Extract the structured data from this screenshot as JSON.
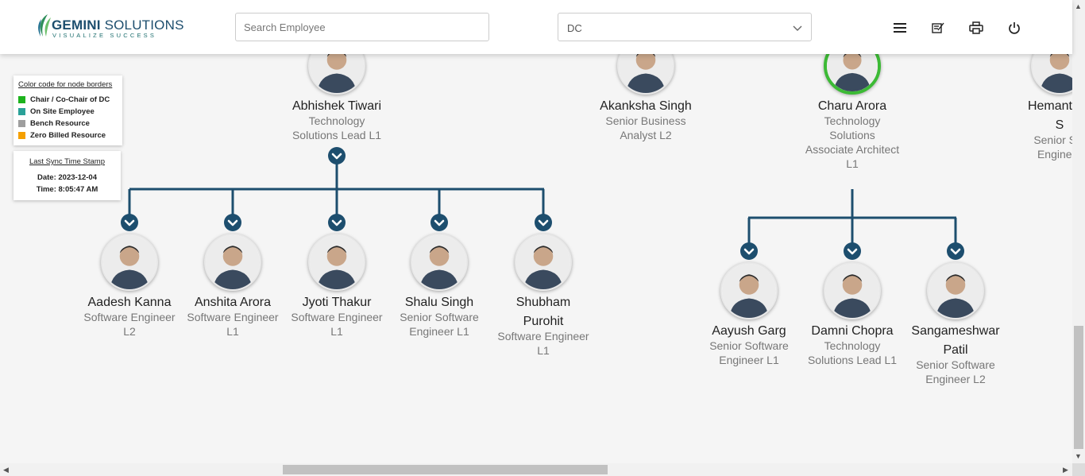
{
  "brand": {
    "name_bold": "GEMINI",
    "name_rest": " SOLUTIONS",
    "tagline": "VISUALIZE SUCCESS"
  },
  "search": {
    "placeholder": "Search Employee"
  },
  "filter": {
    "selected": "DC"
  },
  "header_icons": [
    "menu-icon",
    "edit-note-icon",
    "print-icon",
    "power-icon"
  ],
  "legend": {
    "title": "Color code for node borders",
    "items": [
      {
        "label": "Chair / Co-Chair of DC",
        "color": "#1db31d"
      },
      {
        "label": "On Site Employee",
        "color": "#2aa198"
      },
      {
        "label": "Bench Resource",
        "color": "#9e9e9e"
      },
      {
        "label": "Zero Billed Resource",
        "color": "#f5a000"
      }
    ]
  },
  "sync": {
    "title": "Last Sync Time Stamp",
    "date": "Date: 2023-12-04",
    "time": "Time: 8:05:47 AM"
  },
  "colors": {
    "connector": "#1d4e6e",
    "chair_border": "#3cba35"
  },
  "top_nodes": [
    {
      "name": "Abhishek Tiwari",
      "role": "Technology Solutions Lead L1",
      "role_lines": [
        "Technology",
        "Solutions Lead L1"
      ]
    },
    {
      "name": "Akanksha Singh",
      "role_lines": [
        "Senior Business",
        "Analyst L2"
      ]
    },
    {
      "name": "Charu Arora",
      "role_lines": [
        "Technology",
        "Solutions",
        "Associate Architect",
        "L1"
      ],
      "chair": true
    },
    {
      "name_lines": [
        "Hemanth K",
        "S"
      ],
      "role_lines": [
        "Senior Sof",
        "Engineer"
      ]
    }
  ],
  "group_abhishek": [
    {
      "name": "Aadesh Kanna",
      "role_lines": [
        "Software Engineer",
        "L2"
      ]
    },
    {
      "name": "Anshita Arora",
      "role_lines": [
        "Software Engineer",
        "L1"
      ]
    },
    {
      "name": "Jyoti Thakur",
      "role_lines": [
        "Software Engineer",
        "L1"
      ]
    },
    {
      "name": "Shalu Singh",
      "role_lines": [
        "Senior Software",
        "Engineer L1"
      ]
    },
    {
      "name_lines": [
        "Shubham",
        "Purohit"
      ],
      "role_lines": [
        "Software Engineer",
        "L1"
      ]
    }
  ],
  "group_charu": [
    {
      "name": "Aayush Garg",
      "role_lines": [
        "Senior Software",
        "Engineer L1"
      ]
    },
    {
      "name": "Damni Chopra",
      "role_lines": [
        "Technology",
        "Solutions Lead L1"
      ]
    },
    {
      "name_lines": [
        "Sangameshwar",
        "Patil"
      ],
      "role_lines": [
        "Senior Software",
        "Engineer L2"
      ]
    }
  ]
}
